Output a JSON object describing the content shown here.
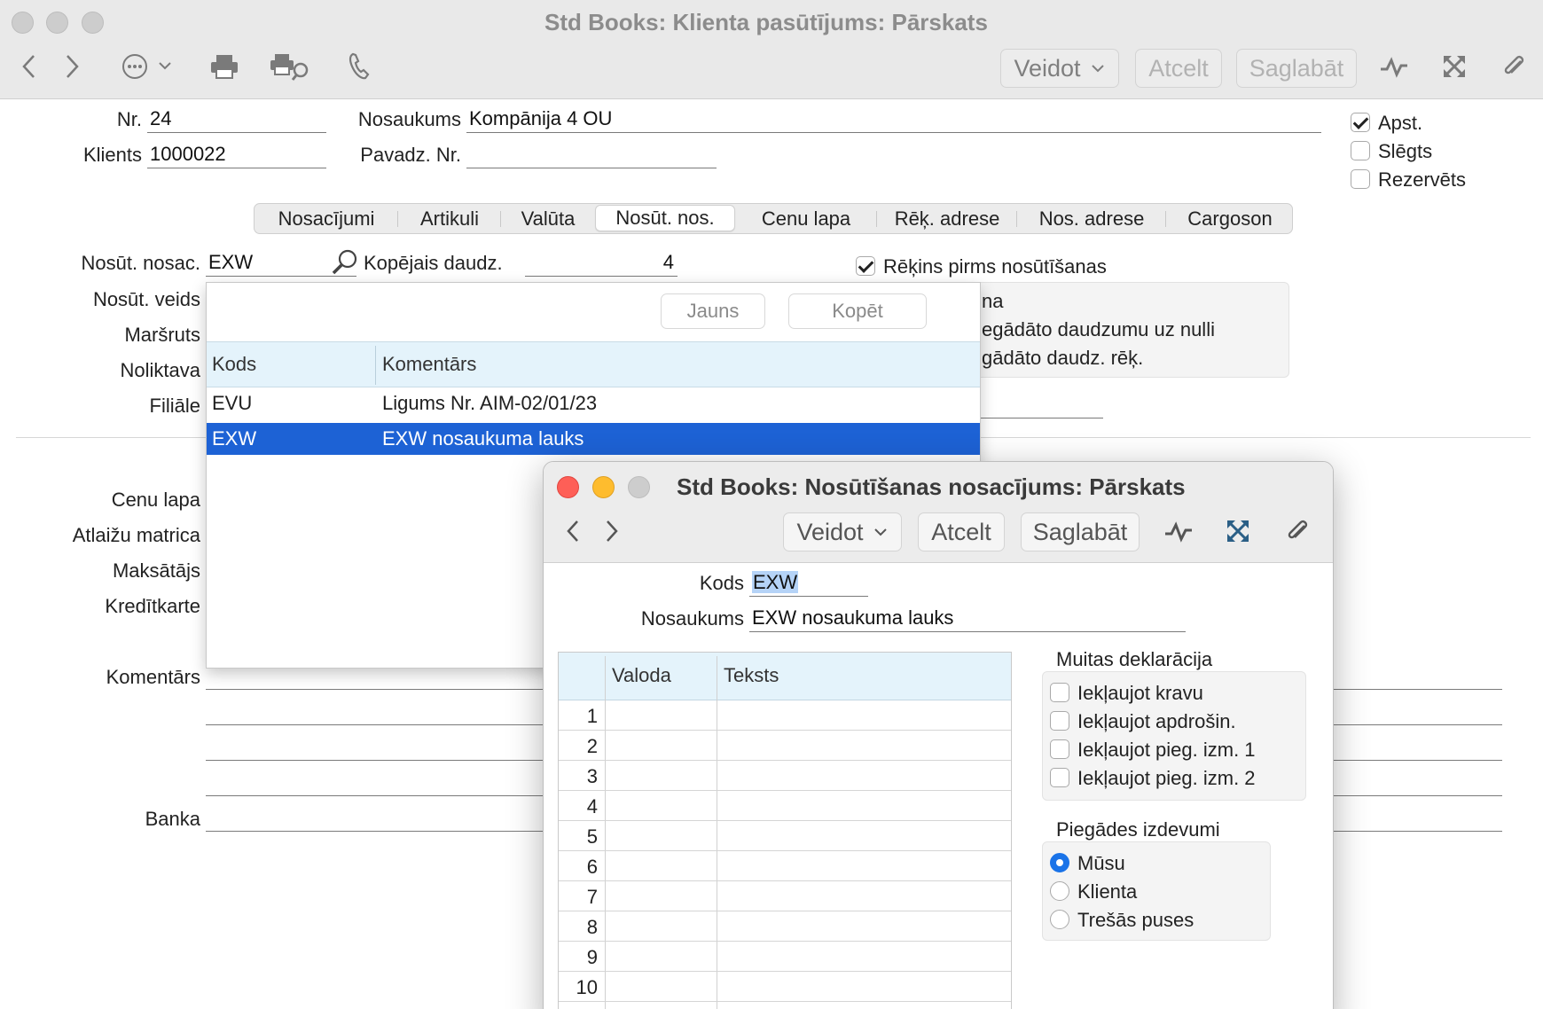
{
  "main_window": {
    "title": "Std Books: Klienta pasūtījums: Pārskats",
    "toolbar": {
      "create": "Veidot",
      "cancel": "Atcelt",
      "save": "Saglabāt"
    }
  },
  "header": {
    "nr_label": "Nr.",
    "nr_value": "24",
    "client_label": "Klients",
    "client_value": "1000022",
    "name_label": "Nosaukums",
    "name_value": "Kompānija 4 OU",
    "invoice_label": "Pavadz. Nr.",
    "invoice_value": ""
  },
  "status_checks": [
    {
      "label": "Apst.",
      "checked": true
    },
    {
      "label": "Slēgts",
      "checked": false
    },
    {
      "label": "Rezervēts",
      "checked": false
    }
  ],
  "tabs": [
    "Nosacījumi",
    "Artikuli",
    "Valūta",
    "Nosūt. nos.",
    "Cenu lapa",
    "Rēķ. adrese",
    "Nos. adrese",
    "Cargoson"
  ],
  "selected_tab": "Nosūt. nos.",
  "delivery": {
    "terms_label": "Nosūt. nosac.",
    "terms_value": "EXW",
    "total_qty_label": "Kopējais daudz.",
    "total_qty_value": "4",
    "invoice_before_label": "Rēķins pirms nosūtīšanas",
    "panel_line1": "na",
    "panel_line2": "egādāto daudzumu uz nulli",
    "panel_line3": "gādāto daudz. rēķ."
  },
  "left_labels": {
    "ship_mode": "Nosūt. veids",
    "route": "Maršruts",
    "warehouse": "Noliktava",
    "branch": "Filiāle",
    "price_list": "Cenu lapa",
    "discount_matrix": "Atlaižu matrica",
    "payer": "Maksātājs",
    "credit_card": "Kredītkarte",
    "comment": "Komentārs",
    "bank": "Banka"
  },
  "dropdown": {
    "new_button": "Jauns",
    "copy_button": "Kopēt",
    "col_code": "Kods",
    "col_comment": "Komentārs",
    "rows": [
      {
        "code": "EVU",
        "comment": "Ligums Nr. AIM-02/01/23",
        "selected": false
      },
      {
        "code": "EXW",
        "comment": "EXW nosaukuma lauks",
        "selected": true
      }
    ]
  },
  "second_window": {
    "title": "Std Books: Nosūtīšanas nosacījums: Pārskats",
    "toolbar": {
      "create": "Veidot",
      "cancel": "Atcelt",
      "save": "Saglabāt"
    },
    "code_label": "Kods",
    "code_value": "EXW",
    "name_label": "Nosaukums",
    "name_value": "EXW nosaukuma lauks",
    "grid": {
      "col_language": "Valoda",
      "col_text": "Teksts",
      "rows": [
        "1",
        "2",
        "3",
        "4",
        "5",
        "6",
        "7",
        "8",
        "9",
        "10"
      ]
    },
    "customs": {
      "title": "Muitas deklarācija",
      "items": [
        "Iekļaujot kravu",
        "Iekļaujot apdrošin.",
        "Iekļaujot pieg. izm. 1",
        "Iekļaujot pieg. izm. 2"
      ]
    },
    "delivery_costs": {
      "title": "Piegādes izdevumi",
      "options": [
        "Mūsu",
        "Klienta",
        "Trešās puses"
      ],
      "selected": "Mūsu"
    }
  },
  "colors": {
    "selection": "#1d62d5",
    "header_blue": "#e4f3fb",
    "radio_accent": "#1a73e8"
  }
}
